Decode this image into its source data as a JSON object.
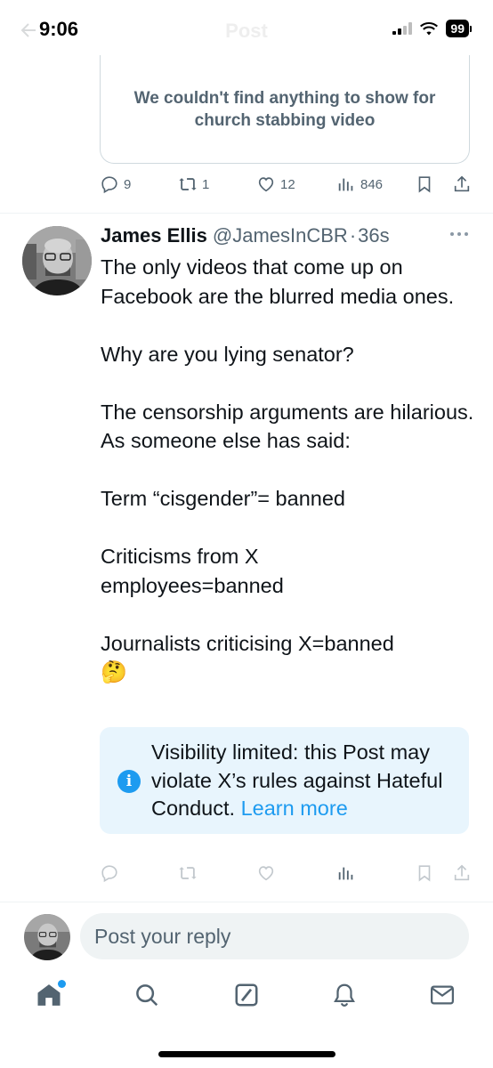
{
  "status_bar": {
    "time": "9:06",
    "title": "Post",
    "battery": "99",
    "icons": [
      "signal-icon",
      "wifi-icon",
      "battery-icon"
    ]
  },
  "embed": {
    "message": "We couldn't find anything to show for church stabbing video"
  },
  "top_actions": {
    "replies": "9",
    "reposts": "1",
    "likes": "12",
    "views": "846"
  },
  "tweet": {
    "author_name": "James Ellis",
    "author_handle": "@JamesInCBR",
    "separator": "·",
    "timestamp": "36s",
    "paragraphs": [
      "The only videos that come up on Facebook are the blurred media ones.",
      "Why are you lying senator?",
      "The censorship arguments are hilarious. As someone else has said:",
      "Term “cisgender”= banned",
      "Criticisms from X employees=banned",
      "Journalists criticising X=banned"
    ],
    "emoji": "🤔"
  },
  "notice": {
    "text": "Visibility limited: this Post may violate X’s rules against Hateful Conduct.",
    "link": "Learn more"
  },
  "reply": {
    "placeholder": "Post your reply"
  },
  "nav": [
    "home-icon",
    "search-icon",
    "grok-icon",
    "notifications-icon",
    "messages-icon"
  ],
  "colors": {
    "accent": "#1d9bf0",
    "secondary_text": "#536471",
    "notice_bg": "#e8f5fd"
  }
}
